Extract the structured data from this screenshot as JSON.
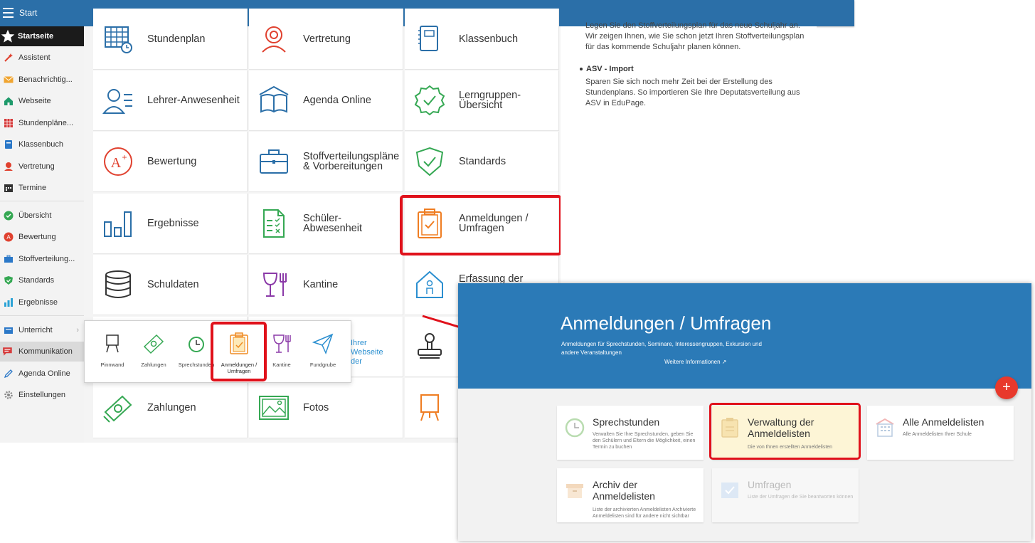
{
  "topbar": {
    "title": "Start"
  },
  "sidebar": {
    "items": [
      {
        "label": "Startseite",
        "icon": "star-icon"
      },
      {
        "label": "Assistent",
        "icon": "wand-icon"
      },
      {
        "label": "Benachrichtig...",
        "icon": "envelope-icon"
      },
      {
        "label": "Webseite",
        "icon": "house-icon"
      },
      {
        "label": "Stundenpläne...",
        "icon": "timetable-icon"
      },
      {
        "label": "Klassenbuch",
        "icon": "book-icon"
      },
      {
        "label": "Vertretung",
        "icon": "substitute-icon"
      },
      {
        "label": "Termine",
        "icon": "calendar-icon"
      },
      {
        "label": "Übersicht",
        "icon": "check-circle-icon"
      },
      {
        "label": "Bewertung",
        "icon": "grade-icon"
      },
      {
        "label": "Stoffverteilung...",
        "icon": "briefcase-icon"
      },
      {
        "label": "Standards",
        "icon": "shield-icon"
      },
      {
        "label": "Ergebnisse",
        "icon": "bar-chart-icon"
      },
      {
        "label": "Unterricht",
        "icon": "lesson-icon"
      },
      {
        "label": "Kommunikation",
        "icon": "chat-icon"
      },
      {
        "label": "Agenda Online",
        "icon": "pen-icon"
      },
      {
        "label": "Einstellungen",
        "icon": "gear-icon"
      }
    ]
  },
  "tiles": [
    {
      "label": "Stundenplan",
      "icon": "timetable-icon"
    },
    {
      "label": "Vertretung",
      "icon": "substitute-icon"
    },
    {
      "label": "Klassenbuch",
      "icon": "notebook-icon"
    },
    {
      "label": "Lehrer-Anwesenheit",
      "icon": "teacher-icon"
    },
    {
      "label": "Agenda Online",
      "icon": "open-book-icon"
    },
    {
      "label": "Lerngruppen-\nÜbersicht",
      "icon": "badge-check-icon"
    },
    {
      "label": "Bewertung",
      "icon": "grade-a-plus-icon"
    },
    {
      "label": "Stoffverteilungspläne\n& Vorbereitungen",
      "icon": "briefcase-icon"
    },
    {
      "label": "Standards",
      "icon": "shield-check-icon"
    },
    {
      "label": "Ergebnisse",
      "icon": "bar-chart-icon"
    },
    {
      "label": "Schüler-\nAbwesenheit",
      "icon": "checklist-icon"
    },
    {
      "label": "Anmeldungen /\nUmfragen",
      "icon": "clipboard-check-icon"
    },
    {
      "label": "Schuldaten",
      "icon": "database-icon"
    },
    {
      "label": "Kantine",
      "icon": "cutlery-icon"
    },
    {
      "label": "Erfassung der",
      "icon": "house-person-icon"
    },
    {
      "label": "Zahlungen",
      "icon": "money-icon"
    },
    {
      "label": "Fotos",
      "icon": "photo-icon"
    }
  ],
  "right_panel": {
    "p1": "Legen Sie den Stoffverteilungsplan für das neue Schuljahr an. Wir zeigen Ihnen, wie Sie schon jetzt Ihren Stoffverteilungsplan für das kommende Schuljahr planen können.",
    "heading": "ASV - Import",
    "p2": "Sparen Sie sich noch mehr Zeit bei der Erstellung des Stundenplans. So importieren Sie Ihre Deputatsverteilung aus ASV in EduPage."
  },
  "popup": {
    "items": [
      {
        "label": "Pinnwand",
        "icon": "easel-icon"
      },
      {
        "label": "Zahlungen",
        "icon": "money-icon"
      },
      {
        "label": "Sprechstunden",
        "icon": "clock-icon"
      },
      {
        "label": "Anmeldungen / Umfragen",
        "icon": "clipboard-check-icon"
      },
      {
        "label": "Kantine",
        "icon": "cutlery-icon"
      },
      {
        "label": "Fundgrube",
        "icon": "paper-plane-icon"
      }
    ],
    "fragment": "Ihrer\nWebseite\nder"
  },
  "zoom": {
    "title": "Anmeldungen / Umfragen",
    "description": "Anmeldungen für Sprechstunden, Seminare, Interessengruppen, Exkursion und andere Veranstaltungen",
    "link": "Weitere Informationen ↗",
    "fab": "+",
    "cards": [
      {
        "title": "Sprechstunden",
        "subtitle": "Verwalten Sie Ihre Sprechstunden, geben Sie den Schülern und Eltern die Möglichkeit, einen Termin zu buchen",
        "icon": "clock-icon"
      },
      {
        "title": "Verwaltung der\nAnmeldelisten",
        "subtitle": "Die von Ihnen erstellten Anmeldelisten",
        "icon": "clipboard-icon"
      },
      {
        "title": "Alle Anmeldelisten",
        "subtitle": "Alle Anmeldelisten Ihrer Schule",
        "icon": "school-icon"
      },
      {
        "title": "Archiv der\nAnmeldelisten",
        "subtitle": "Liste der archivierten Anmeldelisten Archivierte Anmeldelisten sind für andere nicht sichtbar",
        "icon": "archive-box-icon"
      },
      {
        "title": "Umfragen",
        "subtitle": "Liste der Umfragen die Sie beantworten können",
        "icon": "checkbox-icon"
      }
    ]
  },
  "colors": {
    "topbar": "#2b6fa8",
    "highlight": "#e0111b",
    "zoom_header": "#2b7ab7",
    "fab": "#e8392c"
  }
}
